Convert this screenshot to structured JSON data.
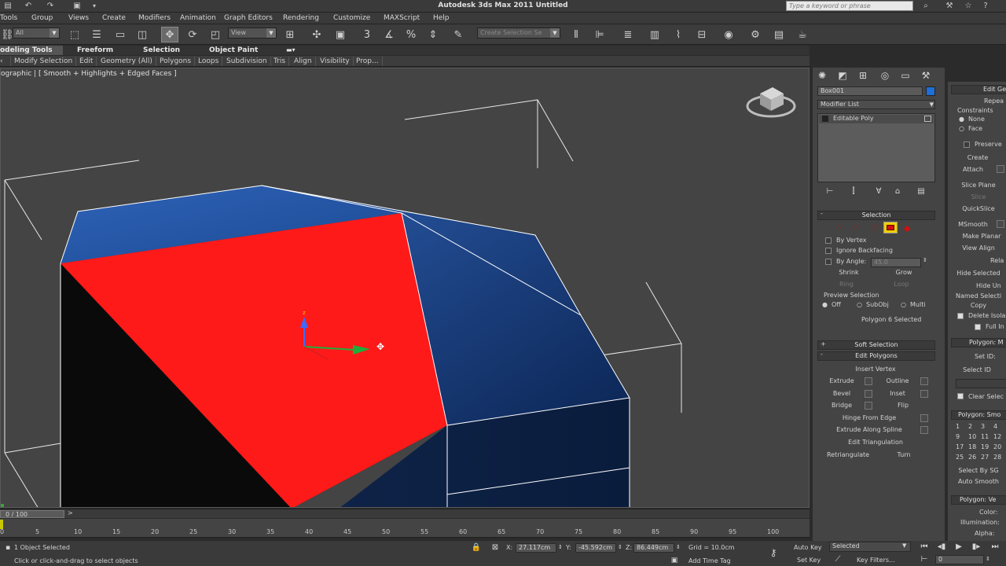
{
  "titlebar": {
    "title": "Autodesk 3ds Max  2011      Untitled",
    "search_placeholder": "Type a keyword or phrase"
  },
  "menus": [
    "Tools",
    "Group",
    "Views",
    "Create",
    "Modifiers",
    "Animation",
    "Graph Editors",
    "Rendering",
    "Customize",
    "MAXScript",
    "Help"
  ],
  "toolbar": {
    "selection_filter": "All",
    "ref_coord": "View",
    "named_selection": "Create Selection Se"
  },
  "ribbon": {
    "tabs": [
      "odeling Tools",
      "Freeform",
      "Selection",
      "Object Paint"
    ],
    "panels": [
      "Modify Selection",
      "Edit",
      "Geometry (All)",
      "Polygons",
      "Loops",
      "Subdivision",
      "Tris",
      "Align",
      "Visibility",
      "Prop..."
    ]
  },
  "viewport": {
    "label": "ographic | [ Smooth + Highlights + Edged Faces ]",
    "face_color": "#ff1a1a",
    "box_color": "#1e4f9a"
  },
  "command_panel": {
    "object_name": "Box001",
    "object_color": "#1e6fd6",
    "modifier_list": "Modifier List",
    "stack_item": "Editable Poly",
    "selection": {
      "title": "Selection",
      "by_vertex": "By Vertex",
      "ignore_backfacing": "Ignore Backfacing",
      "by_angle": "By Angle:",
      "angle_value": "45.0",
      "shrink": "Shrink",
      "grow": "Grow",
      "ring": "Ring",
      "loop": "Loop",
      "preview_title": "Preview Selection",
      "off": "Off",
      "subobj": "SubObj",
      "multi": "Multi",
      "status": "Polygon 6 Selected"
    },
    "soft_selection": "Soft Selection",
    "edit_polygons": {
      "title": "Edit Polygons",
      "insert_vertex": "Insert Vertex",
      "extrude": "Extrude",
      "outline": "Outline",
      "bevel": "Bevel",
      "inset": "Inset",
      "bridge": "Bridge",
      "flip": "Flip",
      "hinge": "Hinge From Edge",
      "extrude_spline": "Extrude Along Spline",
      "edit_tri": "Edit Triangulation",
      "retriangulate": "Retriangulate",
      "turn": "Turn"
    }
  },
  "panel2": {
    "edit_geo": "Edit Ge",
    "repeat": "Repea",
    "constraints": "Constraints",
    "none": "None",
    "face": "Face",
    "preserve": "Preserve",
    "create": "Create",
    "attach": "Attach",
    "slice_plane": "Slice Plane",
    "slice": "Slice",
    "quickslice": "QuickSlice",
    "msmooth": "MSmooth",
    "make_planar": "Make Planar",
    "view_align": "View Align",
    "relax": "Rela",
    "hide_selected": "Hide Selected",
    "hide_unselected": "Hide Un",
    "named_sel": "Named Selecti",
    "copy": "Copy",
    "delete_iso": "Delete Isola",
    "full_int": "Full In",
    "polygon_m": "Polygon: M",
    "set_id": "Set ID:",
    "select_id": "Select ID",
    "clear_sel": "Clear Selec",
    "polygon_sm": "Polygon: Smo",
    "sg": [
      "1",
      "2",
      "3",
      "4",
      "9",
      "10",
      "11",
      "12",
      "17",
      "18",
      "19",
      "20",
      "25",
      "26",
      "27",
      "28"
    ],
    "select_by_sg": "Select By SG",
    "auto_smooth": "Auto Smooth",
    "polygon_v": "Polygon: Ve",
    "color": "Color:",
    "illumination": "Illumination:",
    "alpha": "Alpha:"
  },
  "timeline": {
    "frame": "0 / 100",
    "ticks": [
      "0",
      "5",
      "10",
      "15",
      "20",
      "25",
      "30",
      "35",
      "40",
      "45",
      "50",
      "55",
      "60",
      "65",
      "70",
      "75",
      "80",
      "85",
      "90",
      "95",
      "100"
    ]
  },
  "status": {
    "selected": "1 Object Selected",
    "prompt": "Click or click-and-drag to select objects",
    "x_label": "X:",
    "x": "27.117cm",
    "y_label": "Y:",
    "y": "-45.592cm",
    "z_label": "Z:",
    "z": "86.449cm",
    "grid": "Grid = 10.0cm",
    "add_time_tag": "Add Time Tag",
    "auto_key": "Auto Key",
    "set_key": "Set Key",
    "key_mode": "Selected",
    "key_filters": "Key Filters...",
    "frame_field": "0"
  }
}
